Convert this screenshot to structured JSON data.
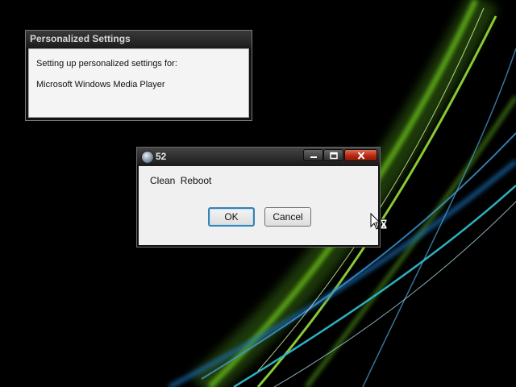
{
  "personalized_settings": {
    "title": "Personalized Settings",
    "line1": "Setting up personalized settings for:",
    "line2": "Microsoft Windows Media Player"
  },
  "dialog": {
    "title": "52",
    "message": "Clean Reboot",
    "ok_label": "OK",
    "cancel_label": "Cancel",
    "icons": {
      "app": "app-icon",
      "minimize": "minimize-icon",
      "maximize": "maximize-icon",
      "close": "close-icon"
    }
  },
  "cursor": {
    "icon": "busy-cursor-icon"
  },
  "colors": {
    "desktop_background": "#000000",
    "wallpaper_green": "#7ed321",
    "wallpaper_blue": "#2e8bd6",
    "close_button": "#c1351a",
    "ok_focus_border": "#3c7fb1"
  }
}
